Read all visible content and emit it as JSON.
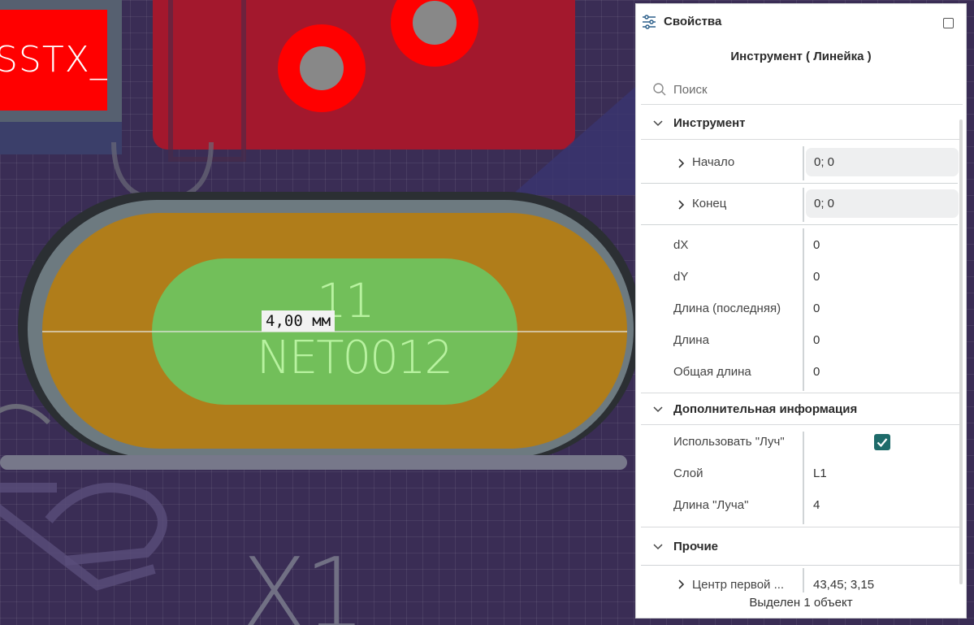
{
  "canvas": {
    "component_label": "SSTX_N",
    "pad_number": "11",
    "pad_net": "NET0012",
    "ruler_label": "4,00 мм",
    "reference": "X1",
    "colors": {
      "background": "#3a2d55",
      "pad_copper": "#b07d1a",
      "pad_hole": "#72bf5a",
      "red_layer": "#a3182d",
      "via_ring": "#ff0000",
      "silkscreen": "#77788a"
    }
  },
  "panel": {
    "title": "Свойства",
    "title_icon": "sliders-icon",
    "maximize_icon": "maximize-icon",
    "tool_title": "Инструмент ( Линейка )",
    "search": {
      "placeholder": "Поиск",
      "value": ""
    },
    "sections": {
      "tool": {
        "label": "Инструмент",
        "start": {
          "label": "Начало",
          "value": "0; 0"
        },
        "end": {
          "label": "Конец",
          "value": "0; 0"
        },
        "rows": [
          {
            "label": "dX",
            "value": "0"
          },
          {
            "label": "dY",
            "value": "0"
          },
          {
            "label": "Длина (последняя)",
            "value": "0"
          },
          {
            "label": "Длина",
            "value": "0"
          },
          {
            "label": "Общая длина",
            "value": "0"
          }
        ]
      },
      "additional": {
        "label": "Дополнительная информация",
        "use_ray": {
          "label": "Использовать \"Луч\"",
          "checked": true
        },
        "layer": {
          "label": "Слой",
          "value": "L1"
        },
        "ray_length": {
          "label": "Длина \"Луча\"",
          "value": "4"
        }
      },
      "other": {
        "label": "Прочие",
        "first_center": {
          "label": "Центр первой ...",
          "value": "43,45; 3,15"
        }
      }
    },
    "footer": "Выделен 1 объект",
    "accent_color": "#1e6b6a"
  }
}
